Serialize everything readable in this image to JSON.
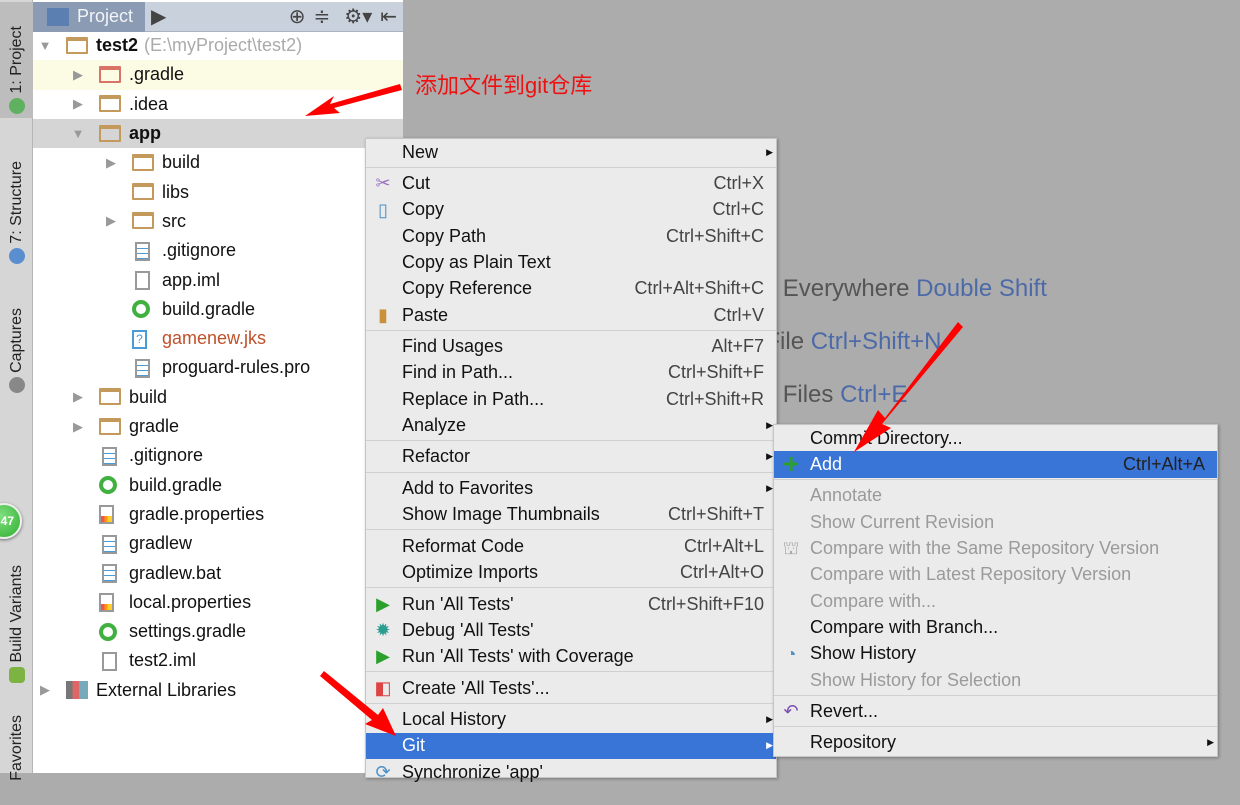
{
  "left_strip": {
    "tabs": [
      "1: Project",
      "7: Structure",
      "Captures",
      "Build Variants",
      "Favorites"
    ],
    "badge": "47"
  },
  "project_panel": {
    "tab_label": "Project",
    "toolbar_icons": [
      "locate-icon",
      "collapse-icon",
      "gear-icon",
      "hide-icon"
    ],
    "tree": [
      {
        "label": "test2",
        "hint": "(E:\\myProject\\test2)",
        "level": 0,
        "arrow": "down",
        "icon": "module-folder",
        "bold": true
      },
      {
        "label": ".gradle",
        "level": 1,
        "arrow": "right",
        "icon": "folder-red",
        "highlight": "yellow"
      },
      {
        "label": ".idea",
        "level": 1,
        "arrow": "right",
        "icon": "folder"
      },
      {
        "label": "app",
        "level": 1,
        "arrow": "down",
        "icon": "android-module-folder",
        "bold": true,
        "highlight": "selected"
      },
      {
        "label": "build",
        "level": 2,
        "arrow": "right",
        "icon": "folder"
      },
      {
        "label": "libs",
        "level": 2,
        "arrow": "",
        "icon": "folder"
      },
      {
        "label": "src",
        "level": 2,
        "arrow": "right",
        "icon": "folder"
      },
      {
        "label": ".gitignore",
        "level": 2,
        "arrow": "",
        "icon": "text-file"
      },
      {
        "label": "app.iml",
        "level": 2,
        "arrow": "",
        "icon": "iml-file"
      },
      {
        "label": "build.gradle",
        "level": 2,
        "arrow": "",
        "icon": "gradle-file"
      },
      {
        "label": "gamenew.jks",
        "level": 2,
        "arrow": "",
        "icon": "unknown-file",
        "color": "#c0502a"
      },
      {
        "label": "proguard-rules.pro",
        "level": 2,
        "arrow": "",
        "icon": "text-file"
      },
      {
        "label": "build",
        "level": 1,
        "arrow": "right",
        "icon": "folder"
      },
      {
        "label": "gradle",
        "level": 1,
        "arrow": "right",
        "icon": "folder"
      },
      {
        "label": ".gitignore",
        "level": 1,
        "arrow": "",
        "icon": "text-file"
      },
      {
        "label": "build.gradle",
        "level": 1,
        "arrow": "",
        "icon": "gradle-file"
      },
      {
        "label": "gradle.properties",
        "level": 1,
        "arrow": "",
        "icon": "properties-file"
      },
      {
        "label": "gradlew",
        "level": 1,
        "arrow": "",
        "icon": "text-file"
      },
      {
        "label": "gradlew.bat",
        "level": 1,
        "arrow": "",
        "icon": "text-file"
      },
      {
        "label": "local.properties",
        "level": 1,
        "arrow": "",
        "icon": "properties-file"
      },
      {
        "label": "settings.gradle",
        "level": 1,
        "arrow": "",
        "icon": "gradle-file"
      },
      {
        "label": "test2.iml",
        "level": 1,
        "arrow": "",
        "icon": "iml-file"
      },
      {
        "label": "External Libraries",
        "level": 0,
        "arrow": "right",
        "icon": "libraries"
      }
    ]
  },
  "editor_hints": [
    {
      "text": "Search Everywhere",
      "key": "Double Shift"
    },
    {
      "text": "Go to File",
      "key": "Ctrl+Shift+N"
    },
    {
      "text": "Recent Files",
      "key": "Ctrl+E"
    }
  ],
  "annotation": "添加文件到git仓库",
  "accent_color": "#3875d7",
  "context_menu": [
    {
      "label": "New",
      "submenu": true
    },
    {
      "sep": true
    },
    {
      "label": "Cut",
      "shortcut": "Ctrl+X",
      "icon": "scissors-icon"
    },
    {
      "label": "Copy",
      "shortcut": "Ctrl+C",
      "icon": "copy-icon"
    },
    {
      "label": "Copy Path",
      "shortcut": "Ctrl+Shift+C"
    },
    {
      "label": "Copy as Plain Text"
    },
    {
      "label": "Copy Reference",
      "shortcut": "Ctrl+Alt+Shift+C"
    },
    {
      "label": "Paste",
      "shortcut": "Ctrl+V",
      "icon": "paste-icon"
    },
    {
      "sep": true
    },
    {
      "label": "Find Usages",
      "shortcut": "Alt+F7"
    },
    {
      "label": "Find in Path...",
      "shortcut": "Ctrl+Shift+F"
    },
    {
      "label": "Replace in Path...",
      "shortcut": "Ctrl+Shift+R"
    },
    {
      "label": "Analyze",
      "submenu": true
    },
    {
      "sep": true
    },
    {
      "label": "Refactor",
      "submenu": true
    },
    {
      "sep": true
    },
    {
      "label": "Add to Favorites",
      "submenu": true
    },
    {
      "label": "Show Image Thumbnails",
      "shortcut": "Ctrl+Shift+T"
    },
    {
      "sep": true
    },
    {
      "label": "Reformat Code",
      "shortcut": "Ctrl+Alt+L"
    },
    {
      "label": "Optimize Imports",
      "shortcut": "Ctrl+Alt+O"
    },
    {
      "sep": true
    },
    {
      "label": "Run 'All Tests'",
      "shortcut": "Ctrl+Shift+F10",
      "icon": "run-icon"
    },
    {
      "label": "Debug 'All Tests'",
      "icon": "debug-icon"
    },
    {
      "label": "Run 'All Tests' with Coverage",
      "icon": "coverage-icon"
    },
    {
      "sep": true
    },
    {
      "label": "Create 'All Tests'...",
      "icon": "create-test-icon"
    },
    {
      "sep": true
    },
    {
      "label": "Local History",
      "submenu": true
    },
    {
      "label": "Git",
      "submenu": true,
      "selected": true
    },
    {
      "label": "Synchronize 'app'",
      "icon": "sync-icon"
    }
  ],
  "git_submenu": [
    {
      "label": "Commit Directory..."
    },
    {
      "label": "Add",
      "shortcut": "Ctrl+Alt+A",
      "icon": "plus-icon",
      "selected": true
    },
    {
      "sep": true
    },
    {
      "label": "Annotate",
      "disabled": true
    },
    {
      "label": "Show Current Revision",
      "disabled": true
    },
    {
      "label": "Compare with the Same Repository Version",
      "disabled": true,
      "icon": "compare-icon"
    },
    {
      "label": "Compare with Latest Repository Version",
      "disabled": true
    },
    {
      "label": "Compare with...",
      "disabled": true
    },
    {
      "label": "Compare with Branch..."
    },
    {
      "label": "Show History",
      "icon": "history-icon"
    },
    {
      "label": "Show History for Selection",
      "disabled": true
    },
    {
      "sep": true
    },
    {
      "label": "Revert...",
      "icon": "revert-icon"
    },
    {
      "sep": true
    },
    {
      "label": "Repository",
      "submenu": true
    }
  ]
}
